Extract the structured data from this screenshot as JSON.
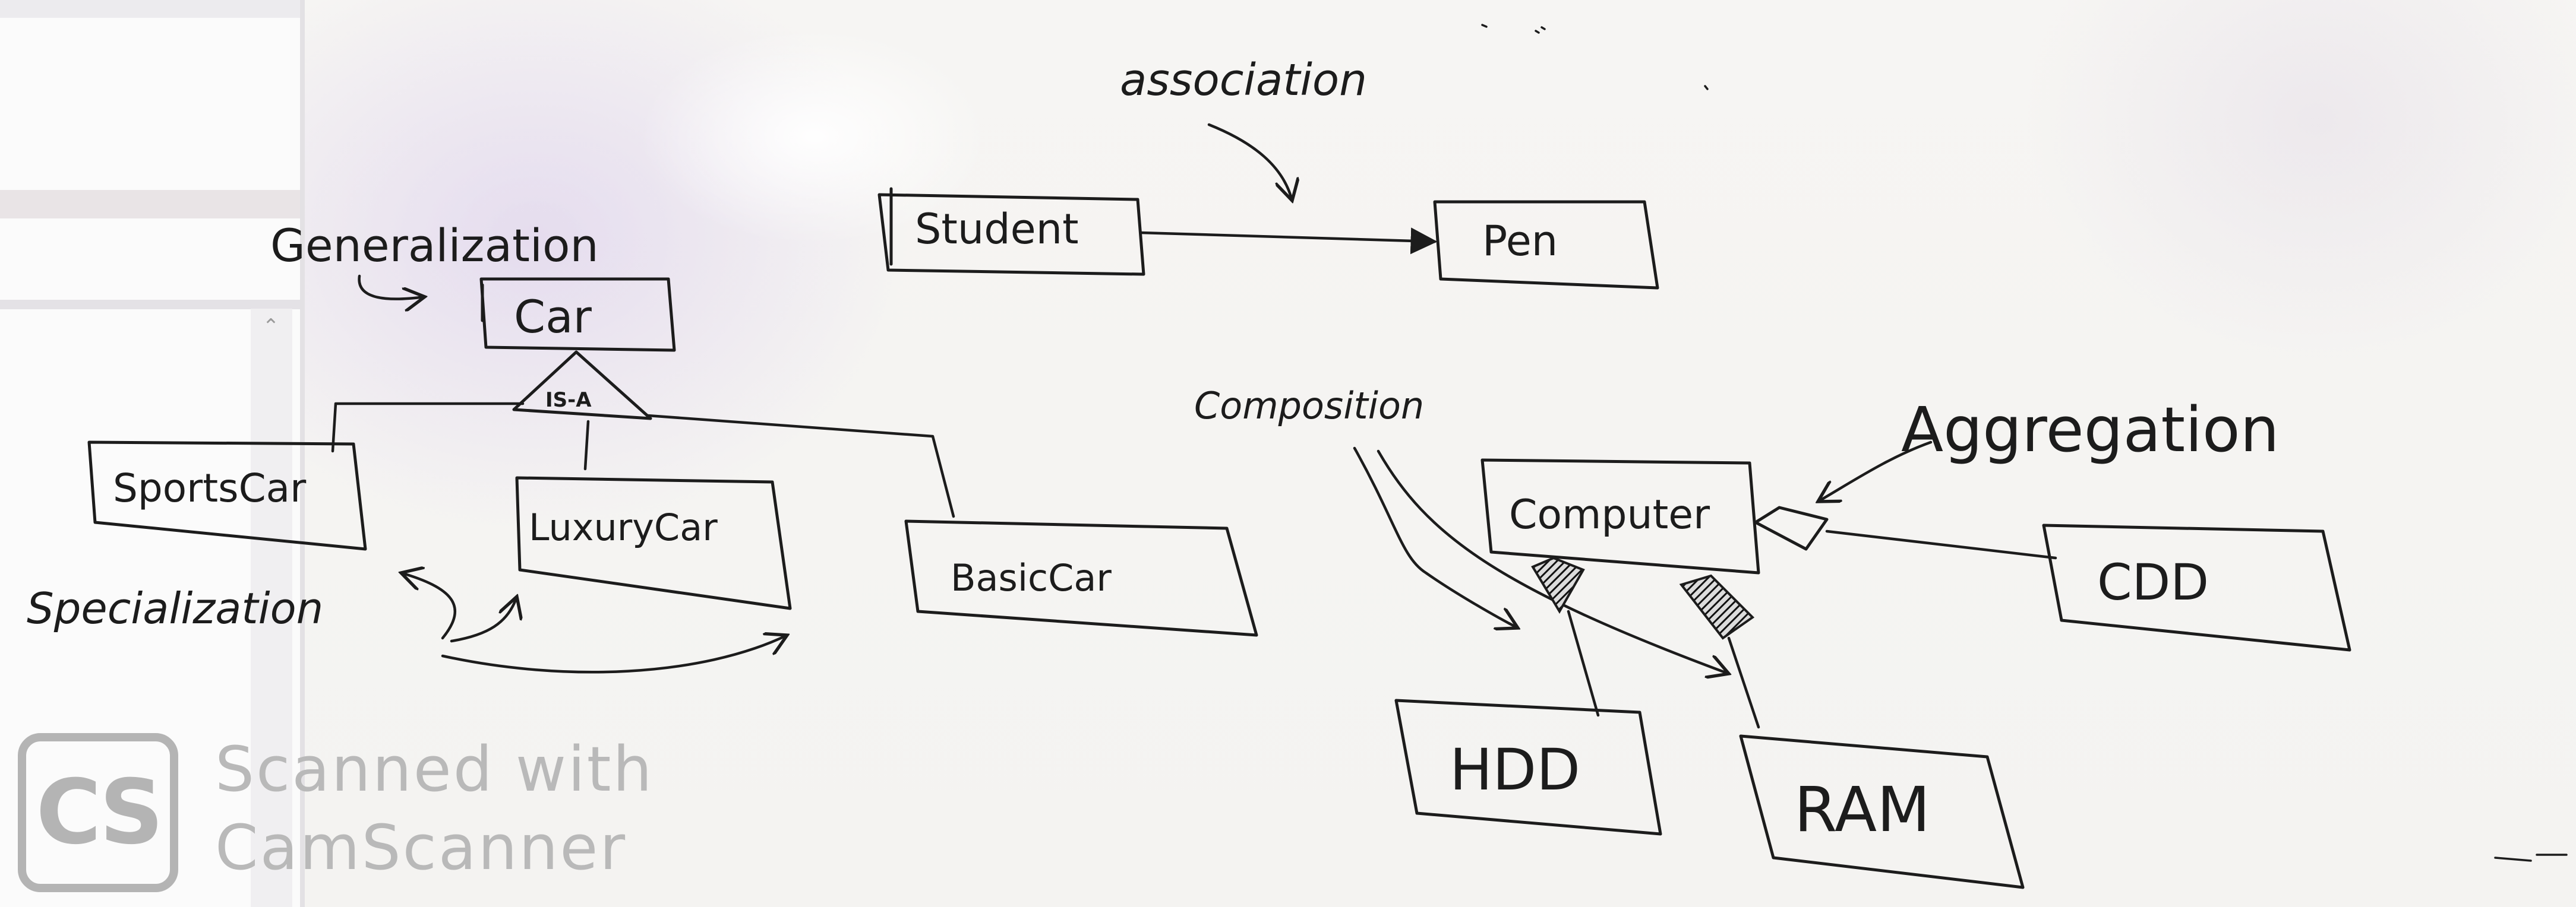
{
  "diagram": {
    "labels": {
      "association": "association",
      "generalization": "Generalization",
      "composition": "Composition",
      "aggregation": "Aggregation",
      "specialization": "Specialization",
      "is_a": "IS-A"
    },
    "classes": {
      "student": "Student",
      "pen": "Pen",
      "car": "Car",
      "sports_car": "SportsCar",
      "luxury_car": "LuxuryCar",
      "basic_car": "BasicCar",
      "computer": "Computer",
      "cdd": "CDD",
      "hdd": "HDD",
      "ram": "RAM"
    }
  },
  "watermark": {
    "logo": "CS",
    "line1": "Scanned with",
    "line2": "CamScanner"
  }
}
